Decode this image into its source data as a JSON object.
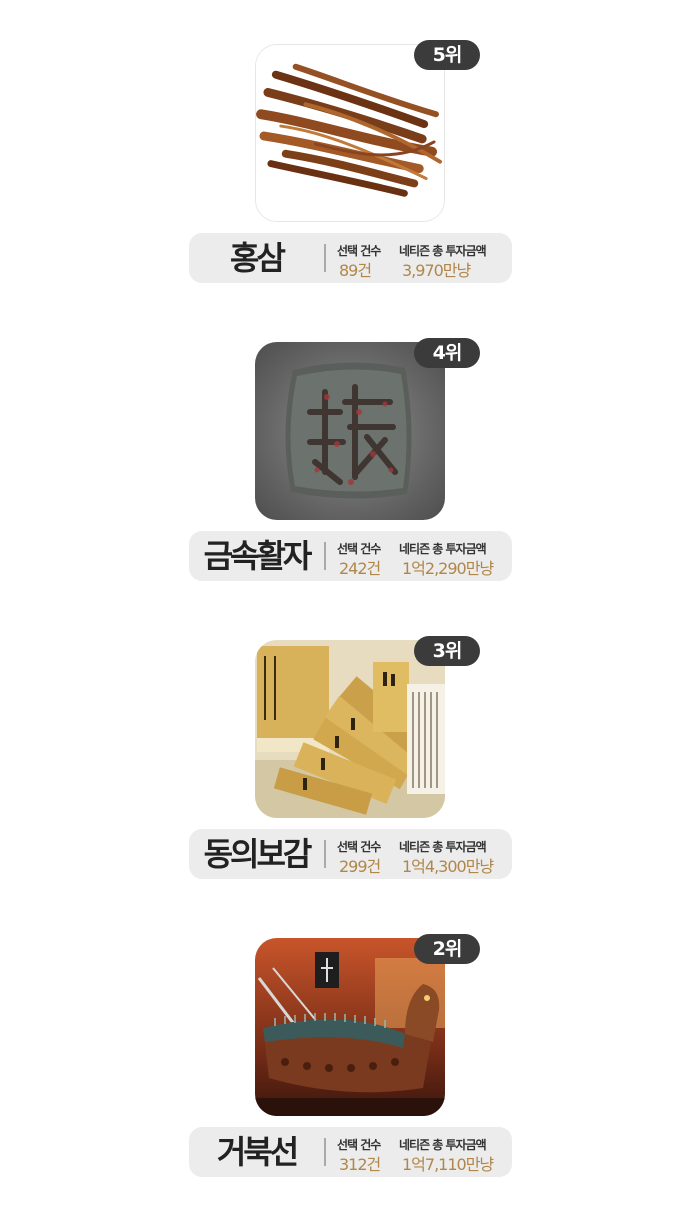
{
  "labels": {
    "count_label": "선택 건수",
    "amount_label": "네티즌 총 투자금액"
  },
  "items": [
    {
      "rank": "5위",
      "name": "홍삼",
      "count": "89건",
      "amount": "3,970만냥",
      "image_icon": "red-ginseng-roots-photo"
    },
    {
      "rank": "4위",
      "name": "금속활자",
      "count": "242건",
      "amount": "1억2,290만냥",
      "image_icon": "metal-movable-type-photo"
    },
    {
      "rank": "3위",
      "name": "동의보감",
      "count": "299건",
      "amount": "1억4,300만냥",
      "image_icon": "dongui-bogam-books-photo"
    },
    {
      "rank": "2위",
      "name": "거북선",
      "count": "312건",
      "amount": "1억7,110만냥",
      "image_icon": "turtle-ship-model-photo"
    }
  ],
  "colors": {
    "badge_bg": "#3b3b3b",
    "bar_bg": "#ececec",
    "value_text": "#b08749",
    "name_text": "#222222"
  }
}
